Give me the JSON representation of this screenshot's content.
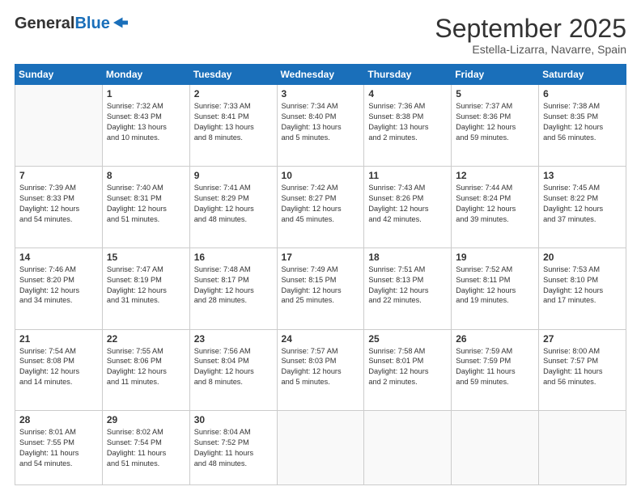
{
  "header": {
    "logo_general": "General",
    "logo_blue": "Blue",
    "month_title": "September 2025",
    "location": "Estella-Lizarra, Navarre, Spain"
  },
  "days_of_week": [
    "Sunday",
    "Monday",
    "Tuesday",
    "Wednesday",
    "Thursday",
    "Friday",
    "Saturday"
  ],
  "weeks": [
    [
      {
        "day": "",
        "info": ""
      },
      {
        "day": "1",
        "info": "Sunrise: 7:32 AM\nSunset: 8:43 PM\nDaylight: 13 hours\nand 10 minutes."
      },
      {
        "day": "2",
        "info": "Sunrise: 7:33 AM\nSunset: 8:41 PM\nDaylight: 13 hours\nand 8 minutes."
      },
      {
        "day": "3",
        "info": "Sunrise: 7:34 AM\nSunset: 8:40 PM\nDaylight: 13 hours\nand 5 minutes."
      },
      {
        "day": "4",
        "info": "Sunrise: 7:36 AM\nSunset: 8:38 PM\nDaylight: 13 hours\nand 2 minutes."
      },
      {
        "day": "5",
        "info": "Sunrise: 7:37 AM\nSunset: 8:36 PM\nDaylight: 12 hours\nand 59 minutes."
      },
      {
        "day": "6",
        "info": "Sunrise: 7:38 AM\nSunset: 8:35 PM\nDaylight: 12 hours\nand 56 minutes."
      }
    ],
    [
      {
        "day": "7",
        "info": "Sunrise: 7:39 AM\nSunset: 8:33 PM\nDaylight: 12 hours\nand 54 minutes."
      },
      {
        "day": "8",
        "info": "Sunrise: 7:40 AM\nSunset: 8:31 PM\nDaylight: 12 hours\nand 51 minutes."
      },
      {
        "day": "9",
        "info": "Sunrise: 7:41 AM\nSunset: 8:29 PM\nDaylight: 12 hours\nand 48 minutes."
      },
      {
        "day": "10",
        "info": "Sunrise: 7:42 AM\nSunset: 8:27 PM\nDaylight: 12 hours\nand 45 minutes."
      },
      {
        "day": "11",
        "info": "Sunrise: 7:43 AM\nSunset: 8:26 PM\nDaylight: 12 hours\nand 42 minutes."
      },
      {
        "day": "12",
        "info": "Sunrise: 7:44 AM\nSunset: 8:24 PM\nDaylight: 12 hours\nand 39 minutes."
      },
      {
        "day": "13",
        "info": "Sunrise: 7:45 AM\nSunset: 8:22 PM\nDaylight: 12 hours\nand 37 minutes."
      }
    ],
    [
      {
        "day": "14",
        "info": "Sunrise: 7:46 AM\nSunset: 8:20 PM\nDaylight: 12 hours\nand 34 minutes."
      },
      {
        "day": "15",
        "info": "Sunrise: 7:47 AM\nSunset: 8:19 PM\nDaylight: 12 hours\nand 31 minutes."
      },
      {
        "day": "16",
        "info": "Sunrise: 7:48 AM\nSunset: 8:17 PM\nDaylight: 12 hours\nand 28 minutes."
      },
      {
        "day": "17",
        "info": "Sunrise: 7:49 AM\nSunset: 8:15 PM\nDaylight: 12 hours\nand 25 minutes."
      },
      {
        "day": "18",
        "info": "Sunrise: 7:51 AM\nSunset: 8:13 PM\nDaylight: 12 hours\nand 22 minutes."
      },
      {
        "day": "19",
        "info": "Sunrise: 7:52 AM\nSunset: 8:11 PM\nDaylight: 12 hours\nand 19 minutes."
      },
      {
        "day": "20",
        "info": "Sunrise: 7:53 AM\nSunset: 8:10 PM\nDaylight: 12 hours\nand 17 minutes."
      }
    ],
    [
      {
        "day": "21",
        "info": "Sunrise: 7:54 AM\nSunset: 8:08 PM\nDaylight: 12 hours\nand 14 minutes."
      },
      {
        "day": "22",
        "info": "Sunrise: 7:55 AM\nSunset: 8:06 PM\nDaylight: 12 hours\nand 11 minutes."
      },
      {
        "day": "23",
        "info": "Sunrise: 7:56 AM\nSunset: 8:04 PM\nDaylight: 12 hours\nand 8 minutes."
      },
      {
        "day": "24",
        "info": "Sunrise: 7:57 AM\nSunset: 8:03 PM\nDaylight: 12 hours\nand 5 minutes."
      },
      {
        "day": "25",
        "info": "Sunrise: 7:58 AM\nSunset: 8:01 PM\nDaylight: 12 hours\nand 2 minutes."
      },
      {
        "day": "26",
        "info": "Sunrise: 7:59 AM\nSunset: 7:59 PM\nDaylight: 11 hours\nand 59 minutes."
      },
      {
        "day": "27",
        "info": "Sunrise: 8:00 AM\nSunset: 7:57 PM\nDaylight: 11 hours\nand 56 minutes."
      }
    ],
    [
      {
        "day": "28",
        "info": "Sunrise: 8:01 AM\nSunset: 7:55 PM\nDaylight: 11 hours\nand 54 minutes."
      },
      {
        "day": "29",
        "info": "Sunrise: 8:02 AM\nSunset: 7:54 PM\nDaylight: 11 hours\nand 51 minutes."
      },
      {
        "day": "30",
        "info": "Sunrise: 8:04 AM\nSunset: 7:52 PM\nDaylight: 11 hours\nand 48 minutes."
      },
      {
        "day": "",
        "info": ""
      },
      {
        "day": "",
        "info": ""
      },
      {
        "day": "",
        "info": ""
      },
      {
        "day": "",
        "info": ""
      }
    ]
  ]
}
